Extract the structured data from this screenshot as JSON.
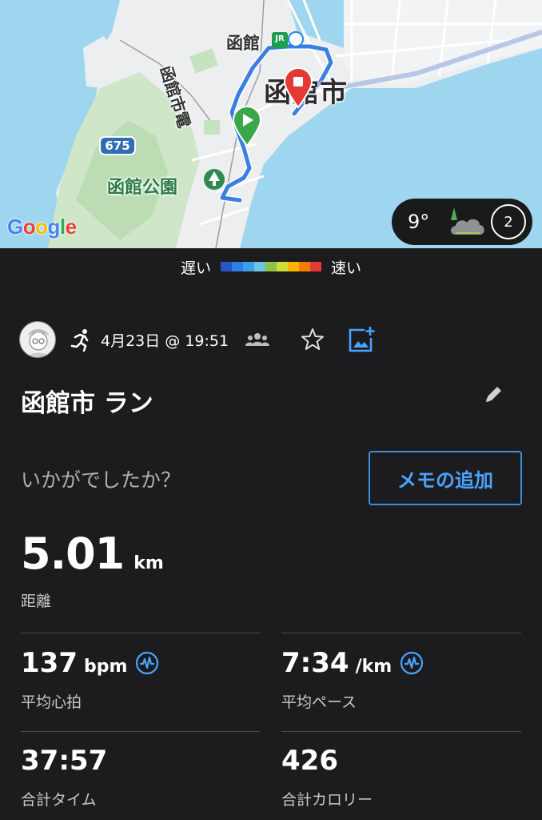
{
  "map": {
    "city_label": "函館市",
    "station_label": "函館",
    "jr_badge": "JR",
    "tram_label": "函館市電",
    "park_label": "函館公園",
    "route_number": "675",
    "google_logo": [
      "G",
      "o",
      "o",
      "g",
      "l",
      "e"
    ],
    "google_colors": [
      "#4285F4",
      "#EA4335",
      "#FBBC05",
      "#4285F4",
      "#34A853",
      "#EA4335"
    ],
    "start_marker_color": "#3aa84a",
    "end_marker_color": "#e53935",
    "route_color": "#3b7fe0"
  },
  "weather": {
    "temperature": "9°",
    "icon": "cloudy-night-icon",
    "laps": "2"
  },
  "speed_legend": {
    "slow_label": "遅い",
    "fast_label": "速い",
    "colors": [
      "#2a55c8",
      "#2d7fe0",
      "#3aa0e8",
      "#6fc2e0",
      "#8bc34a",
      "#cddc39",
      "#ffb300",
      "#f57c00",
      "#e53935"
    ]
  },
  "activity": {
    "date_time": "4月23日 @ 19:51",
    "title": "函館市 ラン",
    "prompt": "いかがでしたか？",
    "memo_button": "メモの追加"
  },
  "stats": {
    "distance_value": "5.01",
    "distance_unit": "km",
    "distance_label": "距離",
    "avg_hr_value": "137",
    "avg_hr_unit": "bpm",
    "avg_hr_label": "平均心拍",
    "avg_pace_value": "7:34",
    "avg_pace_unit": "/km",
    "avg_pace_label": "平均ペース",
    "total_time_value": "37:57",
    "total_time_label": "合計タイム",
    "calories_value": "426",
    "calories_label": "合計カロリー"
  },
  "colors": {
    "background": "#1c1c1e",
    "accent": "#4aa3ff",
    "divider": "#4a4a4a"
  }
}
